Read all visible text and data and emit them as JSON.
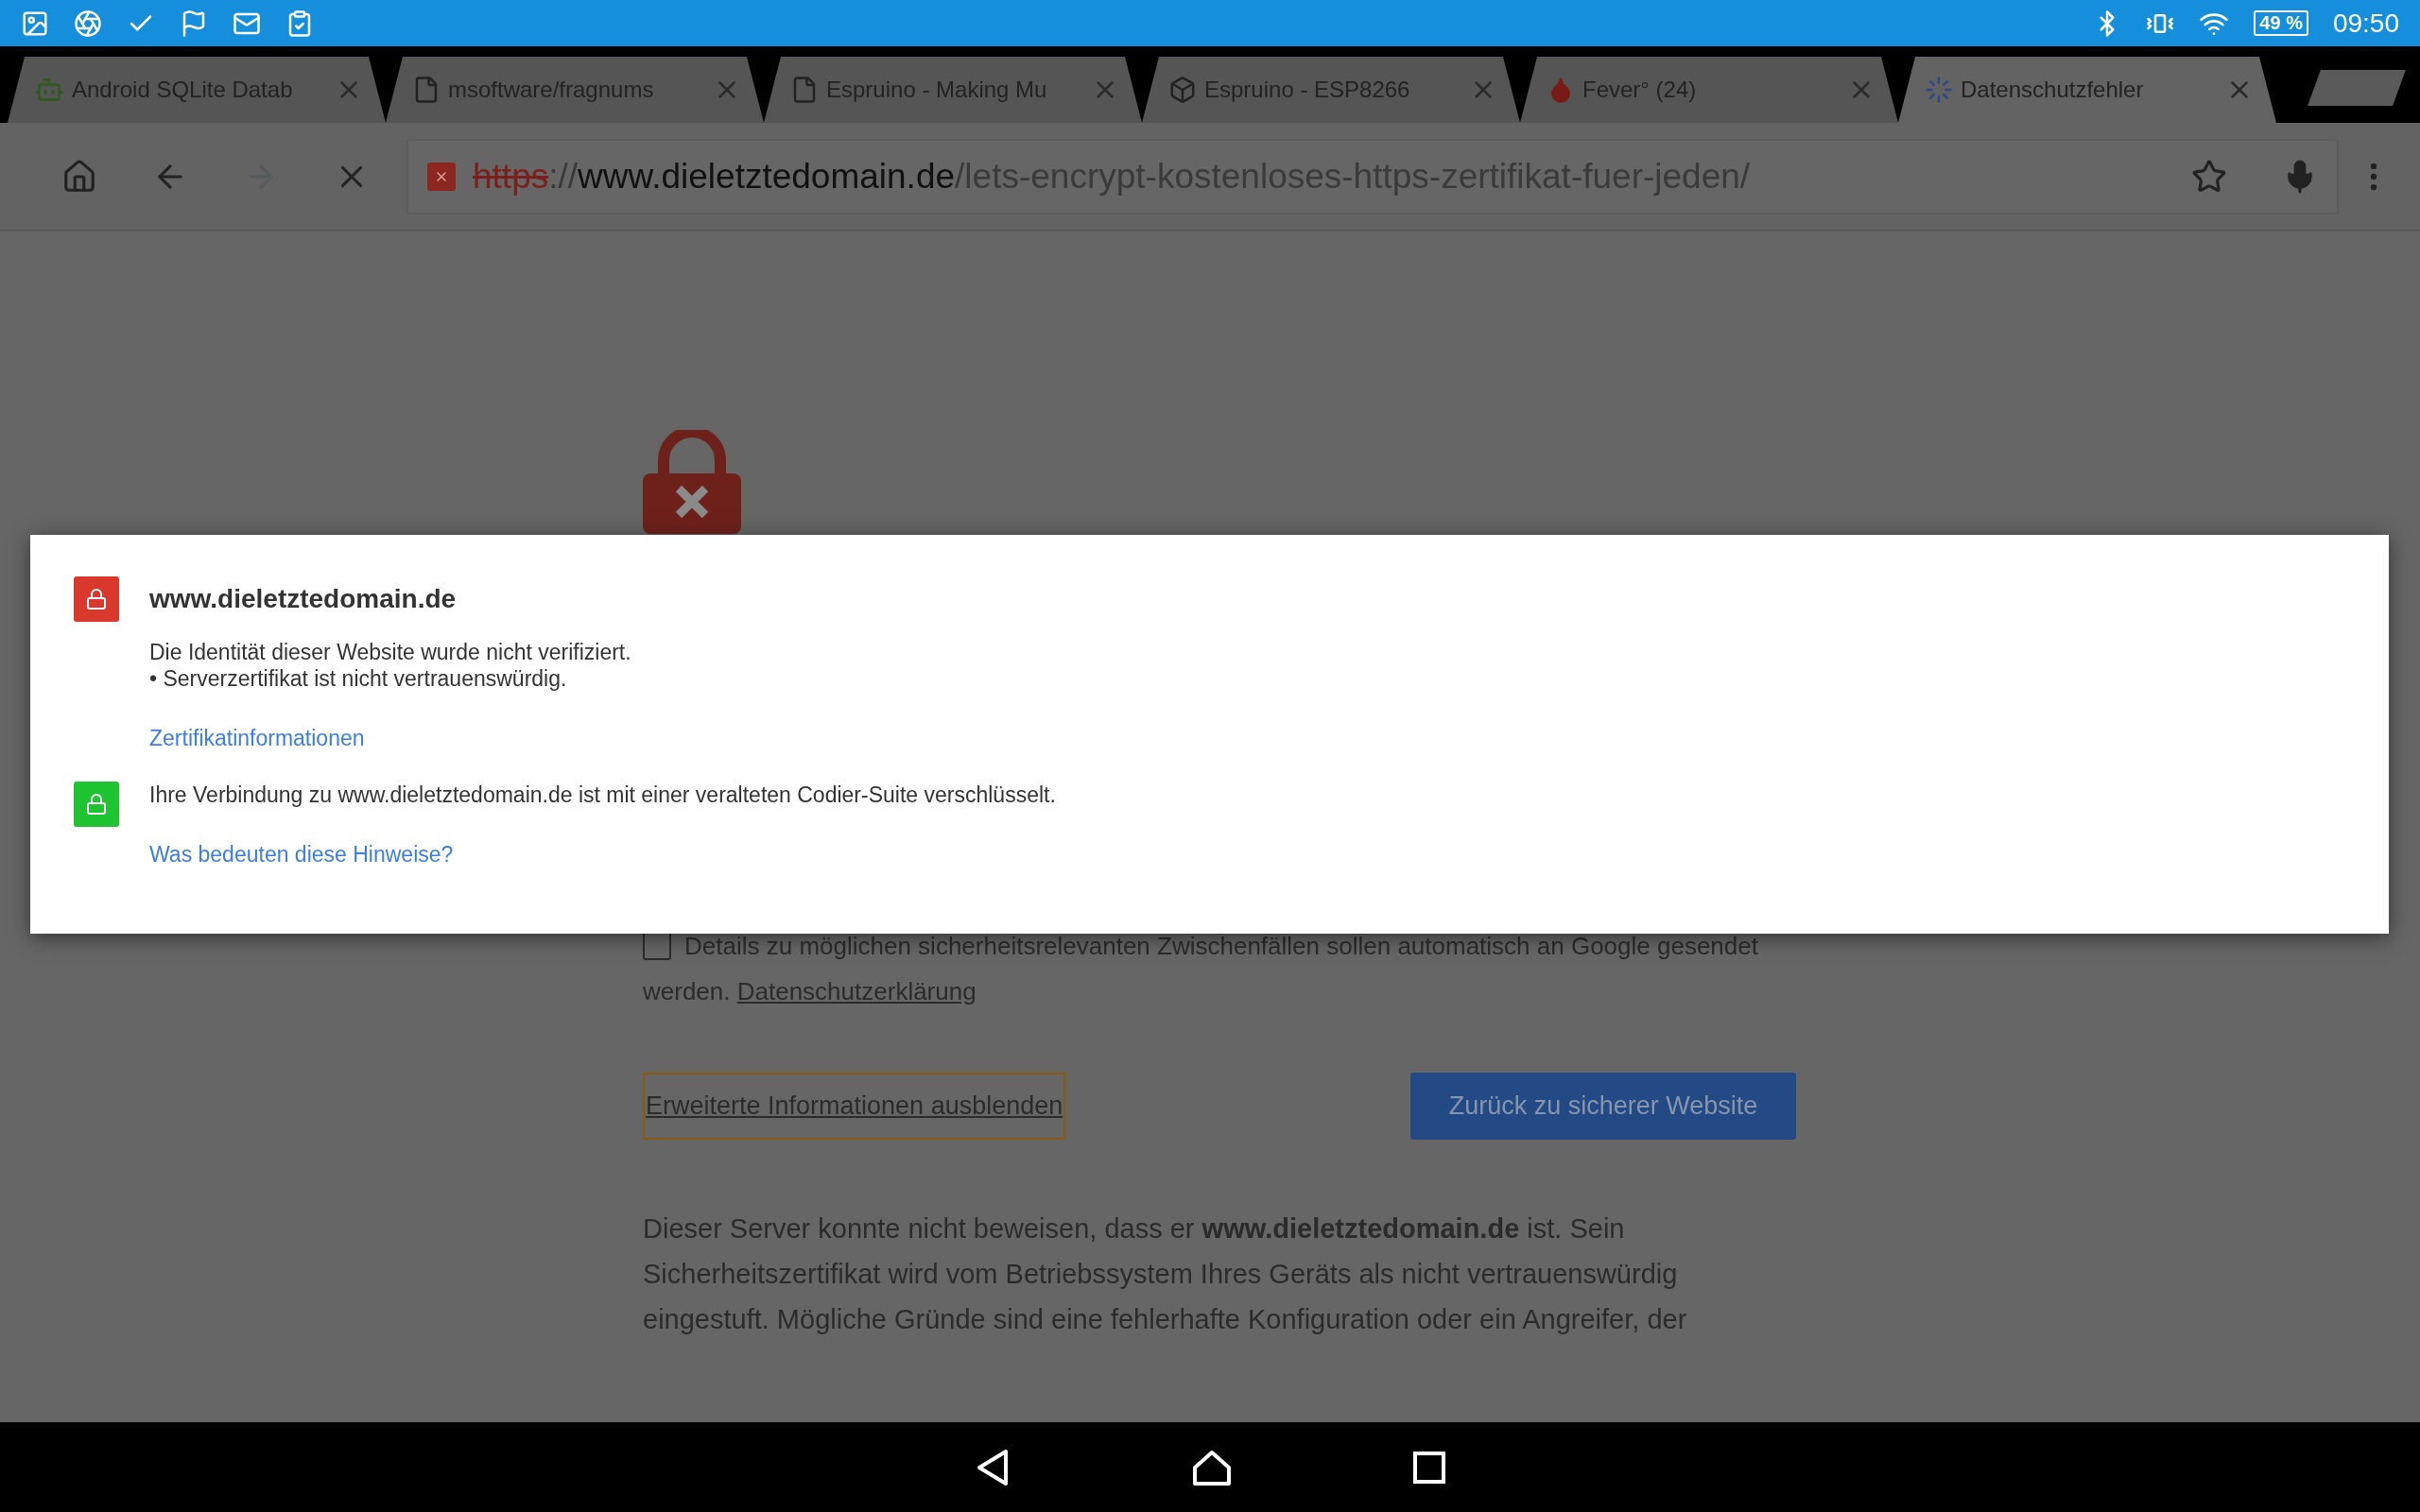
{
  "status_bar": {
    "battery": "49 %",
    "time": "09:50"
  },
  "tabs": [
    {
      "title": "Android SQLite Datab",
      "selected": false
    },
    {
      "title": "msoftware/fragnums",
      "selected": false
    },
    {
      "title": "Espruino - Making Mu",
      "selected": false
    },
    {
      "title": "Espruino - ESP8266",
      "selected": false
    },
    {
      "title": "Fever° (24)",
      "selected": false
    },
    {
      "title": "Datenschutzfehler",
      "selected": true
    }
  ],
  "toolbar": {
    "url_scheme": "https",
    "url_sep": "://",
    "url_host": "www.dieletztedomain.de",
    "url_path": "/lets-encrypt-kostenloses-https-zertifikat-fuer-jeden/"
  },
  "page": {
    "checkbox": {
      "label": "Details zu möglichen sicherheitsrelevanten Zwischenfällen sollen automatisch an Google gesendet werden.",
      "link": "Datenschutzerklärung",
      "checked": false
    },
    "hide_link": "Erweiterte Informationen ausblenden",
    "back_button": "Zurück zu sicherer Website",
    "paragraph": "Dieser Server konnte nicht beweisen, dass er **www.dieletztedomain.de** ist. Sein Sicherheitszertifikat wird vom Betriebssystem Ihres Geräts als nicht vertrauenswürdig eingestuft. Mögliche Gründe sind eine fehlerhafte Konfiguration oder ein Angreifer, der"
  },
  "dialog": {
    "title": "www.dieletztedomain.de",
    "kind": "insecure",
    "sections": [
      {
        "kind": "plain",
        "lines": [
          "Die Identität dieser Website wurde nicht verifiziert.",
          "• Serverzertifikat ist nicht vertrauenswürdig."
        ],
        "link": "Zertifikatinformationen"
      },
      {
        "kind": "secure",
        "lines": [
          "Ihre Verbindung zu www.dieletztedomain.de ist mit einer veralteten Codier-Suite verschlüsselt."
        ],
        "link": "Was bedeuten diese Hinweise?"
      }
    ]
  }
}
